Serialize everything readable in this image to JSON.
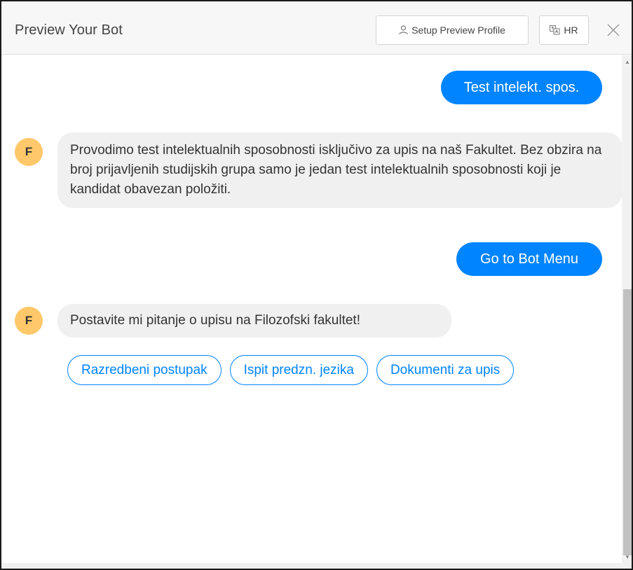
{
  "header": {
    "title": "Preview Your Bot",
    "profile_button": {
      "label": "Setup Preview Profile",
      "icon": "user-icon"
    },
    "language_button": {
      "label": "HR",
      "icon": "translate-icon"
    },
    "close_icon": "close-icon"
  },
  "messages": [
    {
      "from": "user",
      "text": "Test intelekt. spos."
    },
    {
      "from": "bot",
      "avatar": "F",
      "text": "Provodimo test intelektualnih sposobnosti isključivo za upis na naš Fakultet. Bez obzira na broj prijavljenih studijskih grupa samo je jedan test intelektualnih sposobnosti koji je kandidat obavezan položiti."
    },
    {
      "from": "user",
      "text": "Go to Bot Menu"
    },
    {
      "from": "bot",
      "avatar": "F",
      "text": "Postavite mi pitanje o upisu na Filozofski fakultet!"
    }
  ],
  "quick_replies": [
    "Razredbeni postupak",
    "Ispit predzn. jezika",
    "Dokumenti za upis"
  ],
  "colors": {
    "accent": "#0084ff",
    "bot_bubble": "#f0f0f0",
    "avatar": "#ffc86a",
    "header_bg": "#f7f7f7"
  }
}
